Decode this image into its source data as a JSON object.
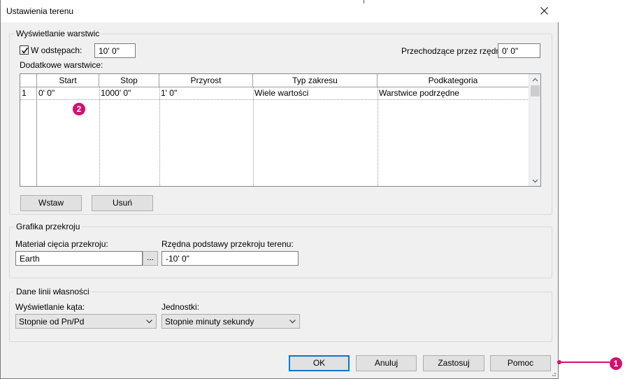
{
  "window": {
    "title": "Ustawienia terenu"
  },
  "contours": {
    "group_label": "Wyświetlanie warstwic",
    "interval_checkbox_label": "W odstępach:",
    "interval_checked": true,
    "interval_value": "10'  0\"",
    "passing_label": "Przechodzące przez rzędną:",
    "passing_value": "0'  0\"",
    "additional_label": "Dodatkowe warstwice:",
    "table": {
      "columns": [
        "Start",
        "Stop",
        "Przyrost",
        "Typ zakresu",
        "Podkategoria"
      ],
      "rows": [
        {
          "num": "1",
          "cells": [
            "0'  0\"",
            "1000'  0\"",
            "1'  0\"",
            "Wiele wartości",
            "Warstwice podrzędne"
          ]
        }
      ]
    },
    "insert_button": "Wstaw",
    "delete_button": "Usuń"
  },
  "section_graphics": {
    "group_label": "Grafika przekroju",
    "material_label": "Materiał cięcia przekroju:",
    "material_value": "Earth",
    "browse_button": "...",
    "base_elev_label": "Rzędna podstawy przekroju terenu:",
    "base_elev_value": "-10'  0\""
  },
  "property_lines": {
    "group_label": "Dane linii własności",
    "angle_label": "Wyświetlanie kąta:",
    "angle_value": "Stopnie od Pn/Pd",
    "units_label": "Jednostki:",
    "units_value": "Stopnie minuty sekundy"
  },
  "footer": {
    "ok": "OK",
    "cancel": "Anuluj",
    "apply": "Zastosuj",
    "help": "Pomoc"
  },
  "callouts": {
    "badge_1": "1",
    "badge_2": "2"
  },
  "colors": {
    "callout": "#d2116e",
    "default_button_border": "#0078d7",
    "dialog_bg": "#f0f0f0"
  }
}
